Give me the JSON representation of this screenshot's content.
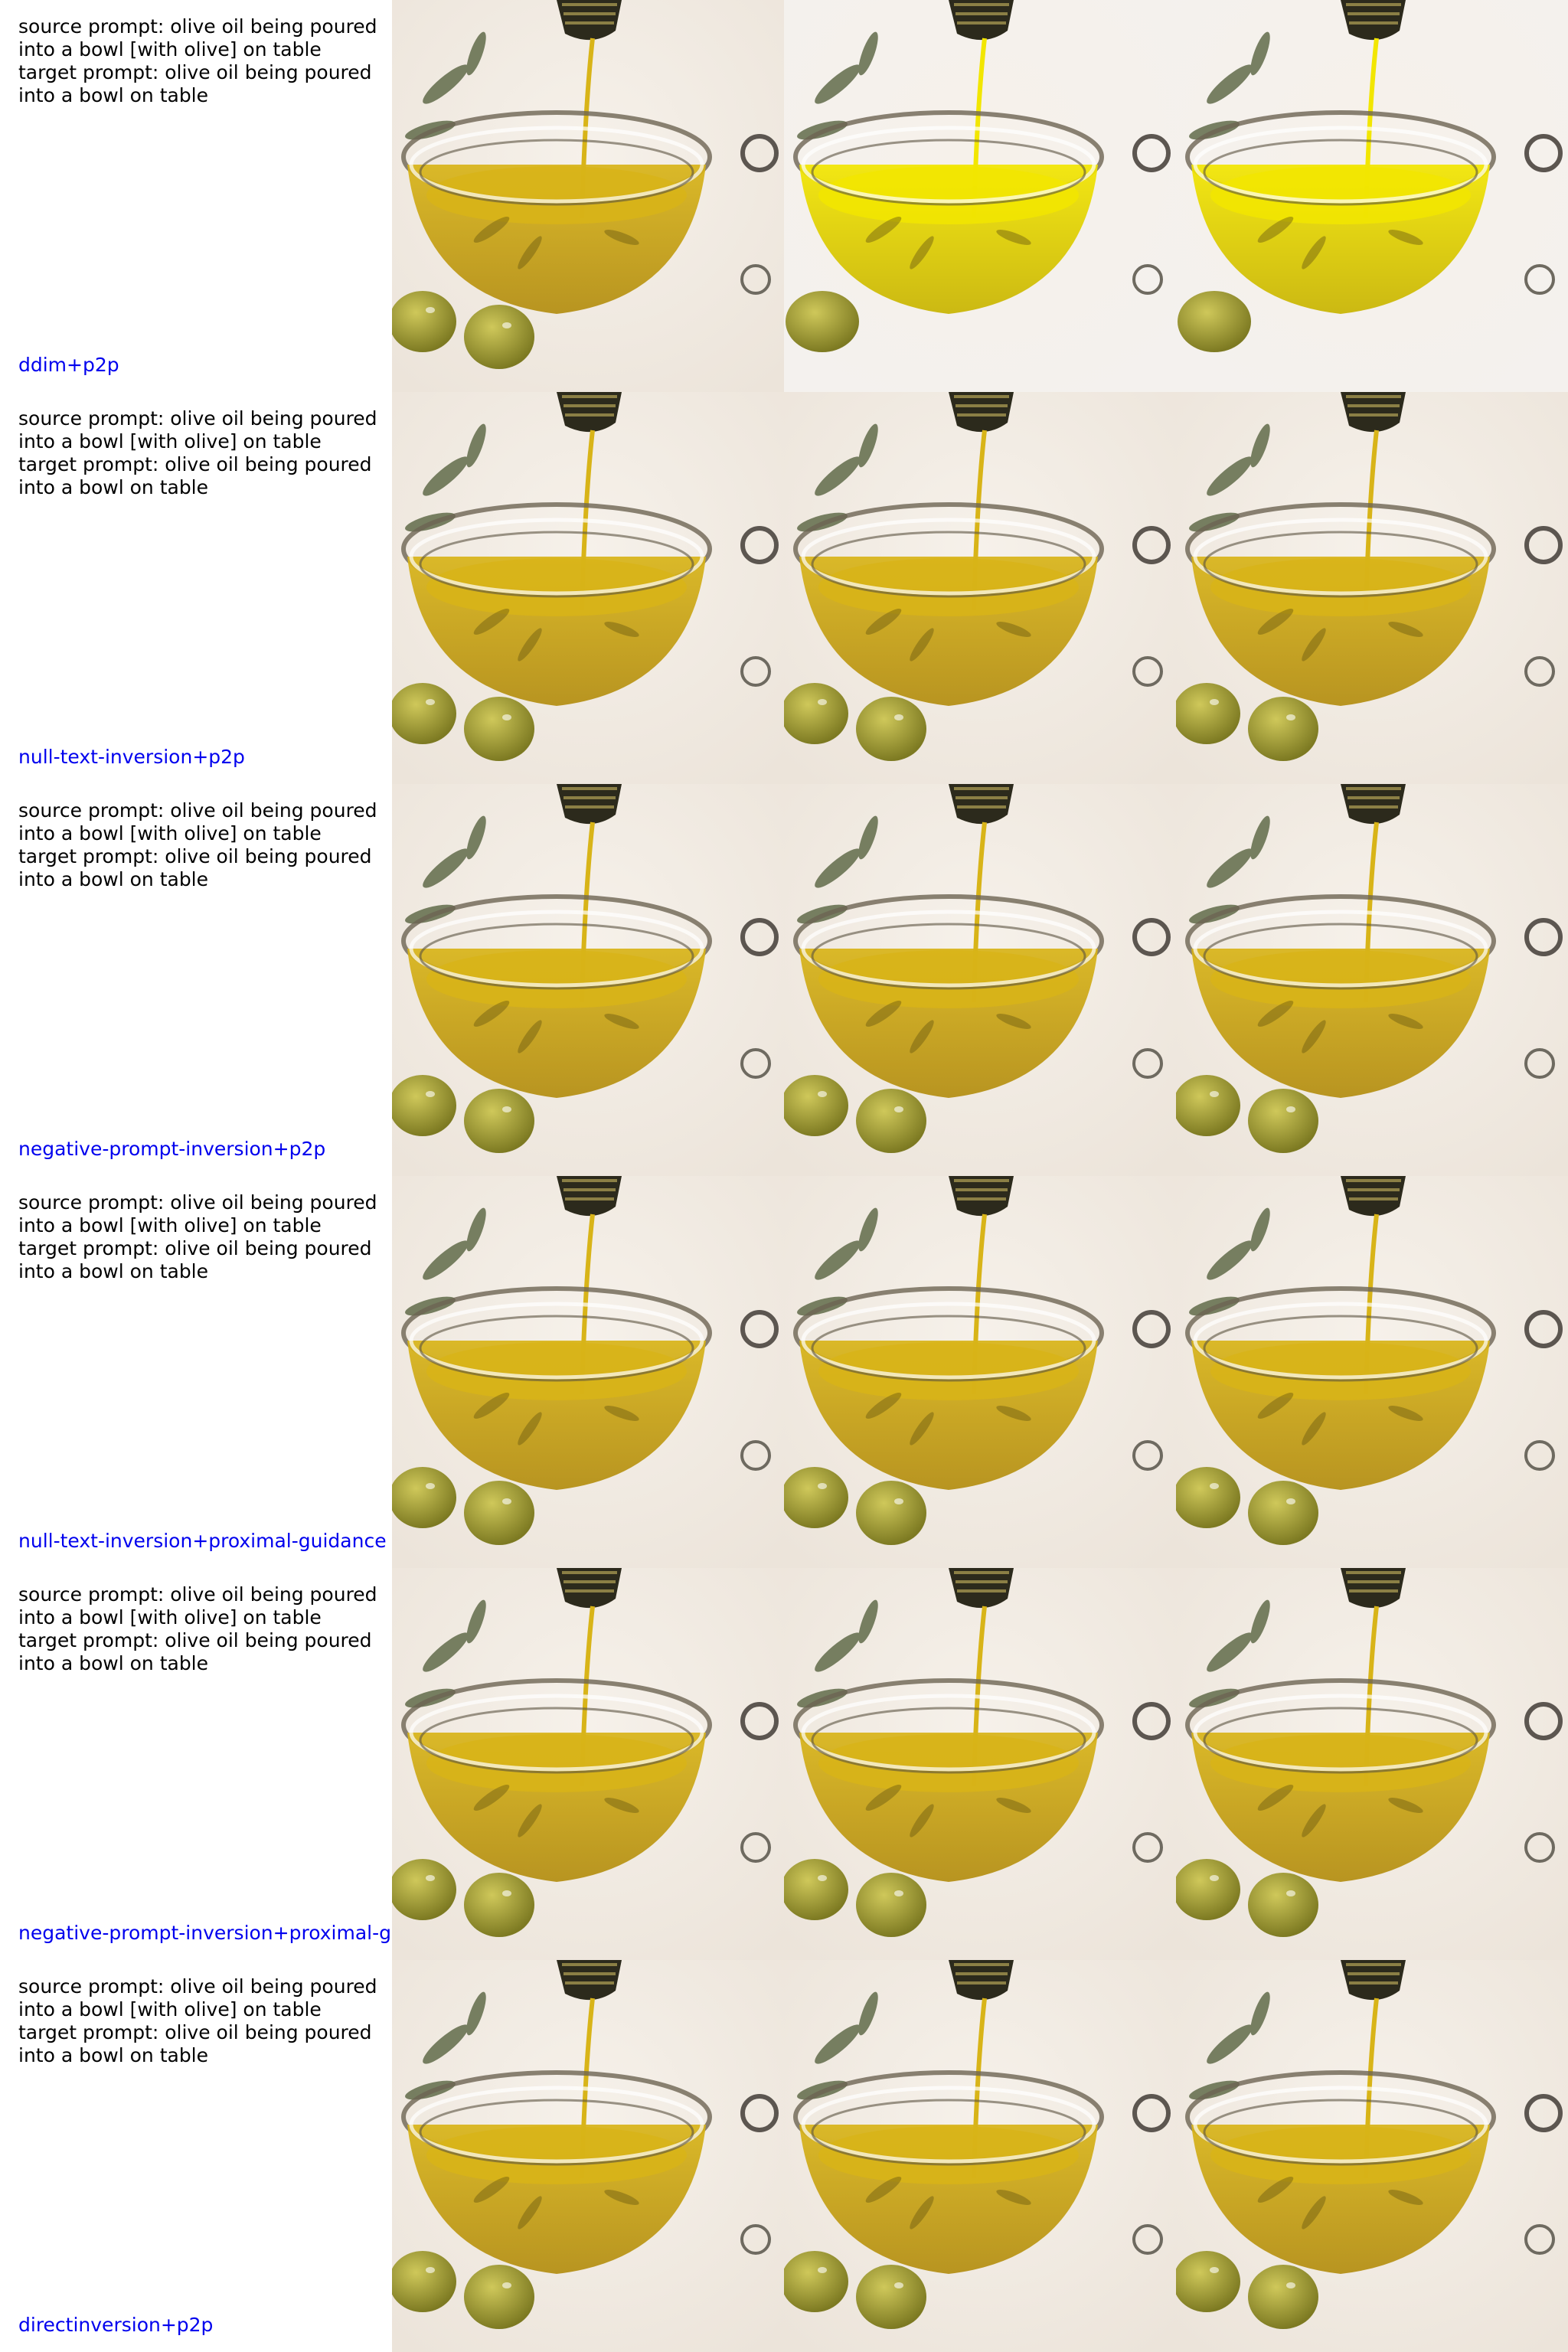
{
  "grid": {
    "rows": [
      {
        "source_prompt": [
          "source prompt: olive oil being poured",
          "into a bowl [with olive] on table"
        ],
        "target_prompt": [
          "target prompt: olive oil being poured",
          "into a bowl on table"
        ],
        "method": "ddim+p2p",
        "images": [
          "olive-oil-original",
          "olive-oil-reconstruction",
          "olive-oil-edited"
        ]
      },
      {
        "source_prompt": [
          "source prompt: olive oil being poured",
          "into a bowl [with olive] on table"
        ],
        "target_prompt": [
          "target prompt: olive oil being poured",
          "into a bowl on table"
        ],
        "method": "null-text-inversion+p2p",
        "images": [
          "olive-oil-original",
          "olive-oil-reconstruction",
          "olive-oil-edited"
        ]
      },
      {
        "source_prompt": [
          "source prompt: olive oil being poured",
          "into a bowl [with olive] on table"
        ],
        "target_prompt": [
          "target prompt: olive oil being poured",
          "into a bowl on table"
        ],
        "method": "negative-prompt-inversion+p2p",
        "images": [
          "olive-oil-original",
          "olive-oil-reconstruction",
          "olive-oil-edited"
        ]
      },
      {
        "source_prompt": [
          "source prompt: olive oil being poured",
          "into a bowl [with olive] on table"
        ],
        "target_prompt": [
          "target prompt: olive oil being poured",
          "into a bowl on table"
        ],
        "method": "null-text-inversion+proximal-guidance",
        "images": [
          "olive-oil-original",
          "olive-oil-reconstruction",
          "olive-oil-edited"
        ]
      },
      {
        "source_prompt": [
          "source prompt: olive oil being poured",
          "into a bowl [with olive] on table"
        ],
        "target_prompt": [
          "target prompt: olive oil being poured",
          "into a bowl on table"
        ],
        "method": "negative-prompt-inversion+proximal-guidance",
        "images": [
          "olive-oil-original",
          "olive-oil-reconstruction",
          "olive-oil-edited"
        ]
      },
      {
        "source_prompt": [
          "source prompt: olive oil being poured",
          "into a bowl [with olive] on table"
        ],
        "target_prompt": [
          "target prompt: olive oil being poured",
          "into a bowl on table"
        ],
        "method": "directinversion+p2p",
        "images": [
          "olive-oil-original",
          "olive-oil-reconstruction",
          "olive-oil-edited"
        ]
      }
    ]
  },
  "colors": {
    "method_label": "#0000ee",
    "prompt_text": "#000000",
    "oil": "#d8b418",
    "oil_saturated": "#f2e600",
    "olive": "#a8a23a",
    "table": "#ece4da"
  }
}
